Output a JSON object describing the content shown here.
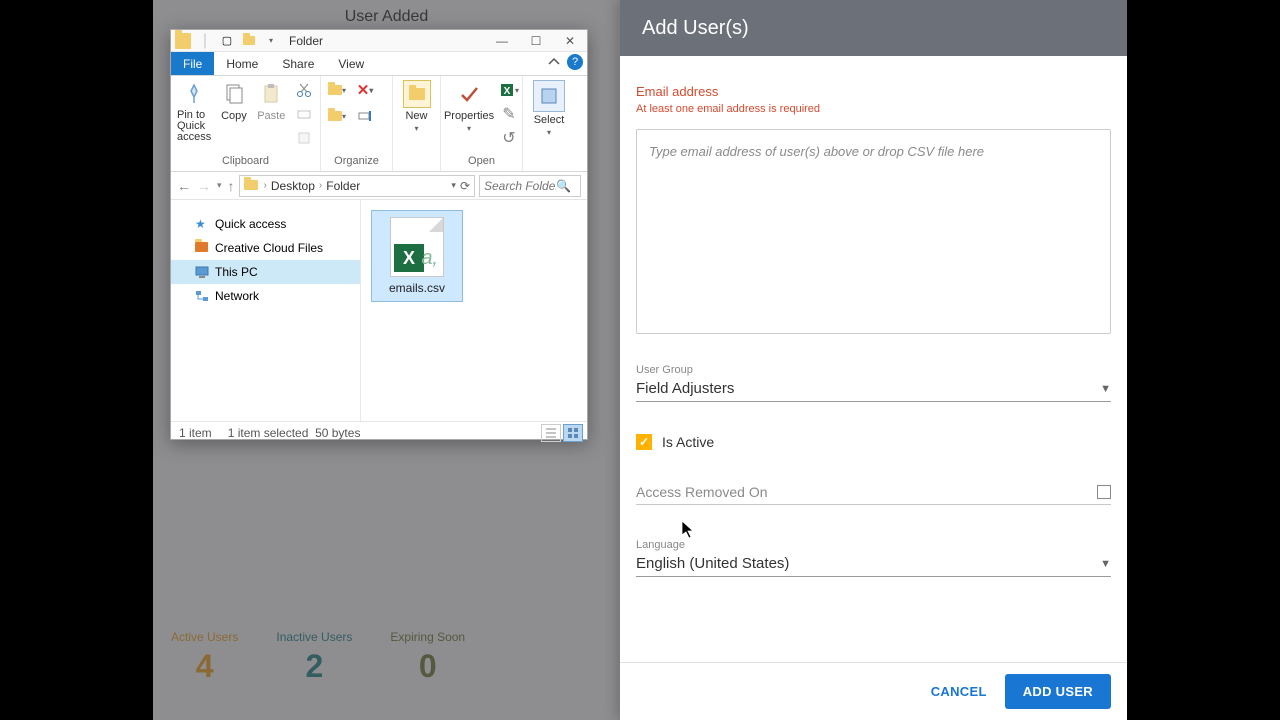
{
  "background": {
    "title": "User Added",
    "stats": {
      "active": {
        "label": "Active Users",
        "count": "4"
      },
      "inactive": {
        "label": "Inactive Users",
        "count": "2"
      },
      "expiring": {
        "label": "Expiring Soon",
        "count": "0"
      }
    }
  },
  "explorer": {
    "title": "Folder",
    "tabs": {
      "file": "File",
      "home": "Home",
      "share": "Share",
      "view": "View"
    },
    "ribbon": {
      "pin": "Pin to Quick access",
      "copy": "Copy",
      "paste": "Paste",
      "new": "New",
      "properties": "Properties",
      "select": "Select",
      "clipboard": "Clipboard",
      "organize": "Organize",
      "open": "Open"
    },
    "breadcrumb": {
      "a": "Desktop",
      "b": "Folder"
    },
    "search_placeholder": "Search Folder",
    "nav": {
      "quick": "Quick access",
      "ccf": "Creative Cloud Files",
      "thispc": "This PC",
      "network": "Network"
    },
    "file": {
      "name": "emails.csv"
    },
    "status": {
      "count": "1 item",
      "selected": "1 item selected",
      "size": "50 bytes"
    }
  },
  "drawer": {
    "title": "Add User(s)",
    "email_label": "Email address",
    "email_error": "At least one email address is required",
    "email_placeholder": "Type email address of user(s) above or drop CSV file here",
    "user_group_label": "User Group",
    "user_group_value": "Field Adjusters",
    "is_active": "Is Active",
    "access_removed": "Access Removed On",
    "language_label": "Language",
    "language_value": "English (United States)",
    "cancel": "CANCEL",
    "add": "ADD USER"
  }
}
